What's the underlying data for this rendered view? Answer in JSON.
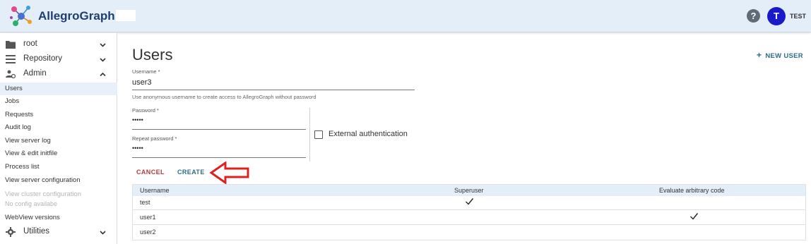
{
  "header": {
    "app_name": "AllegroGraph",
    "help_icon": "help-circle-icon",
    "avatar_initial": "T",
    "user_name": "TEST"
  },
  "sidebar": {
    "groups": [
      {
        "label": "root",
        "icon": "folder-icon",
        "chevron": "chevron-down-icon"
      },
      {
        "label": "Repository",
        "icon": "list-icon",
        "chevron": "chevron-down-icon"
      },
      {
        "label": "Admin",
        "icon": "admin-gear-user-icon",
        "chevron": "chevron-up-icon"
      }
    ],
    "items": [
      {
        "label": "Users"
      },
      {
        "label": "Jobs"
      },
      {
        "label": "Requests"
      },
      {
        "label": "Audit log"
      },
      {
        "label": "View server log"
      },
      {
        "label": "View & edit initfile"
      },
      {
        "label": "Process list"
      },
      {
        "label": "View server configuration"
      },
      {
        "label": "View cluster configuration"
      },
      {
        "label": "No config availabe"
      },
      {
        "label": "WebView versions"
      }
    ],
    "utilities": {
      "label": "Utilities",
      "icon": "gear-icon",
      "chevron": "chevron-down-icon"
    }
  },
  "main": {
    "title": "Users",
    "new_user_label": "NEW USER",
    "form": {
      "username_label": "Username *",
      "username_value": "user3",
      "username_hint": "Use anonymous username to create access to AllegroGraph without password",
      "password_label": "Password *",
      "password_value": "•••••",
      "repeat_password_label": "Repeat password *",
      "repeat_password_value": "•••••",
      "external_auth_label": "External authentication",
      "external_auth_checked": false
    },
    "cancel_label": "CANCEL",
    "create_label": "CREATE",
    "table": {
      "columns": [
        "Username",
        "Superuser",
        "Evaluate arbitrary code"
      ],
      "rows": [
        {
          "username": "test",
          "superuser": true,
          "eval_code": false
        },
        {
          "username": "user1",
          "superuser": false,
          "eval_code": true
        },
        {
          "username": "user2",
          "superuser": false,
          "eval_code": false
        }
      ]
    }
  },
  "colors": {
    "header_bg": "#e3eef8",
    "accent": "#2d6e87",
    "cancel": "#b73b3b",
    "avatar": "#1a1ac8",
    "annotation_arrow": "#e02020"
  }
}
